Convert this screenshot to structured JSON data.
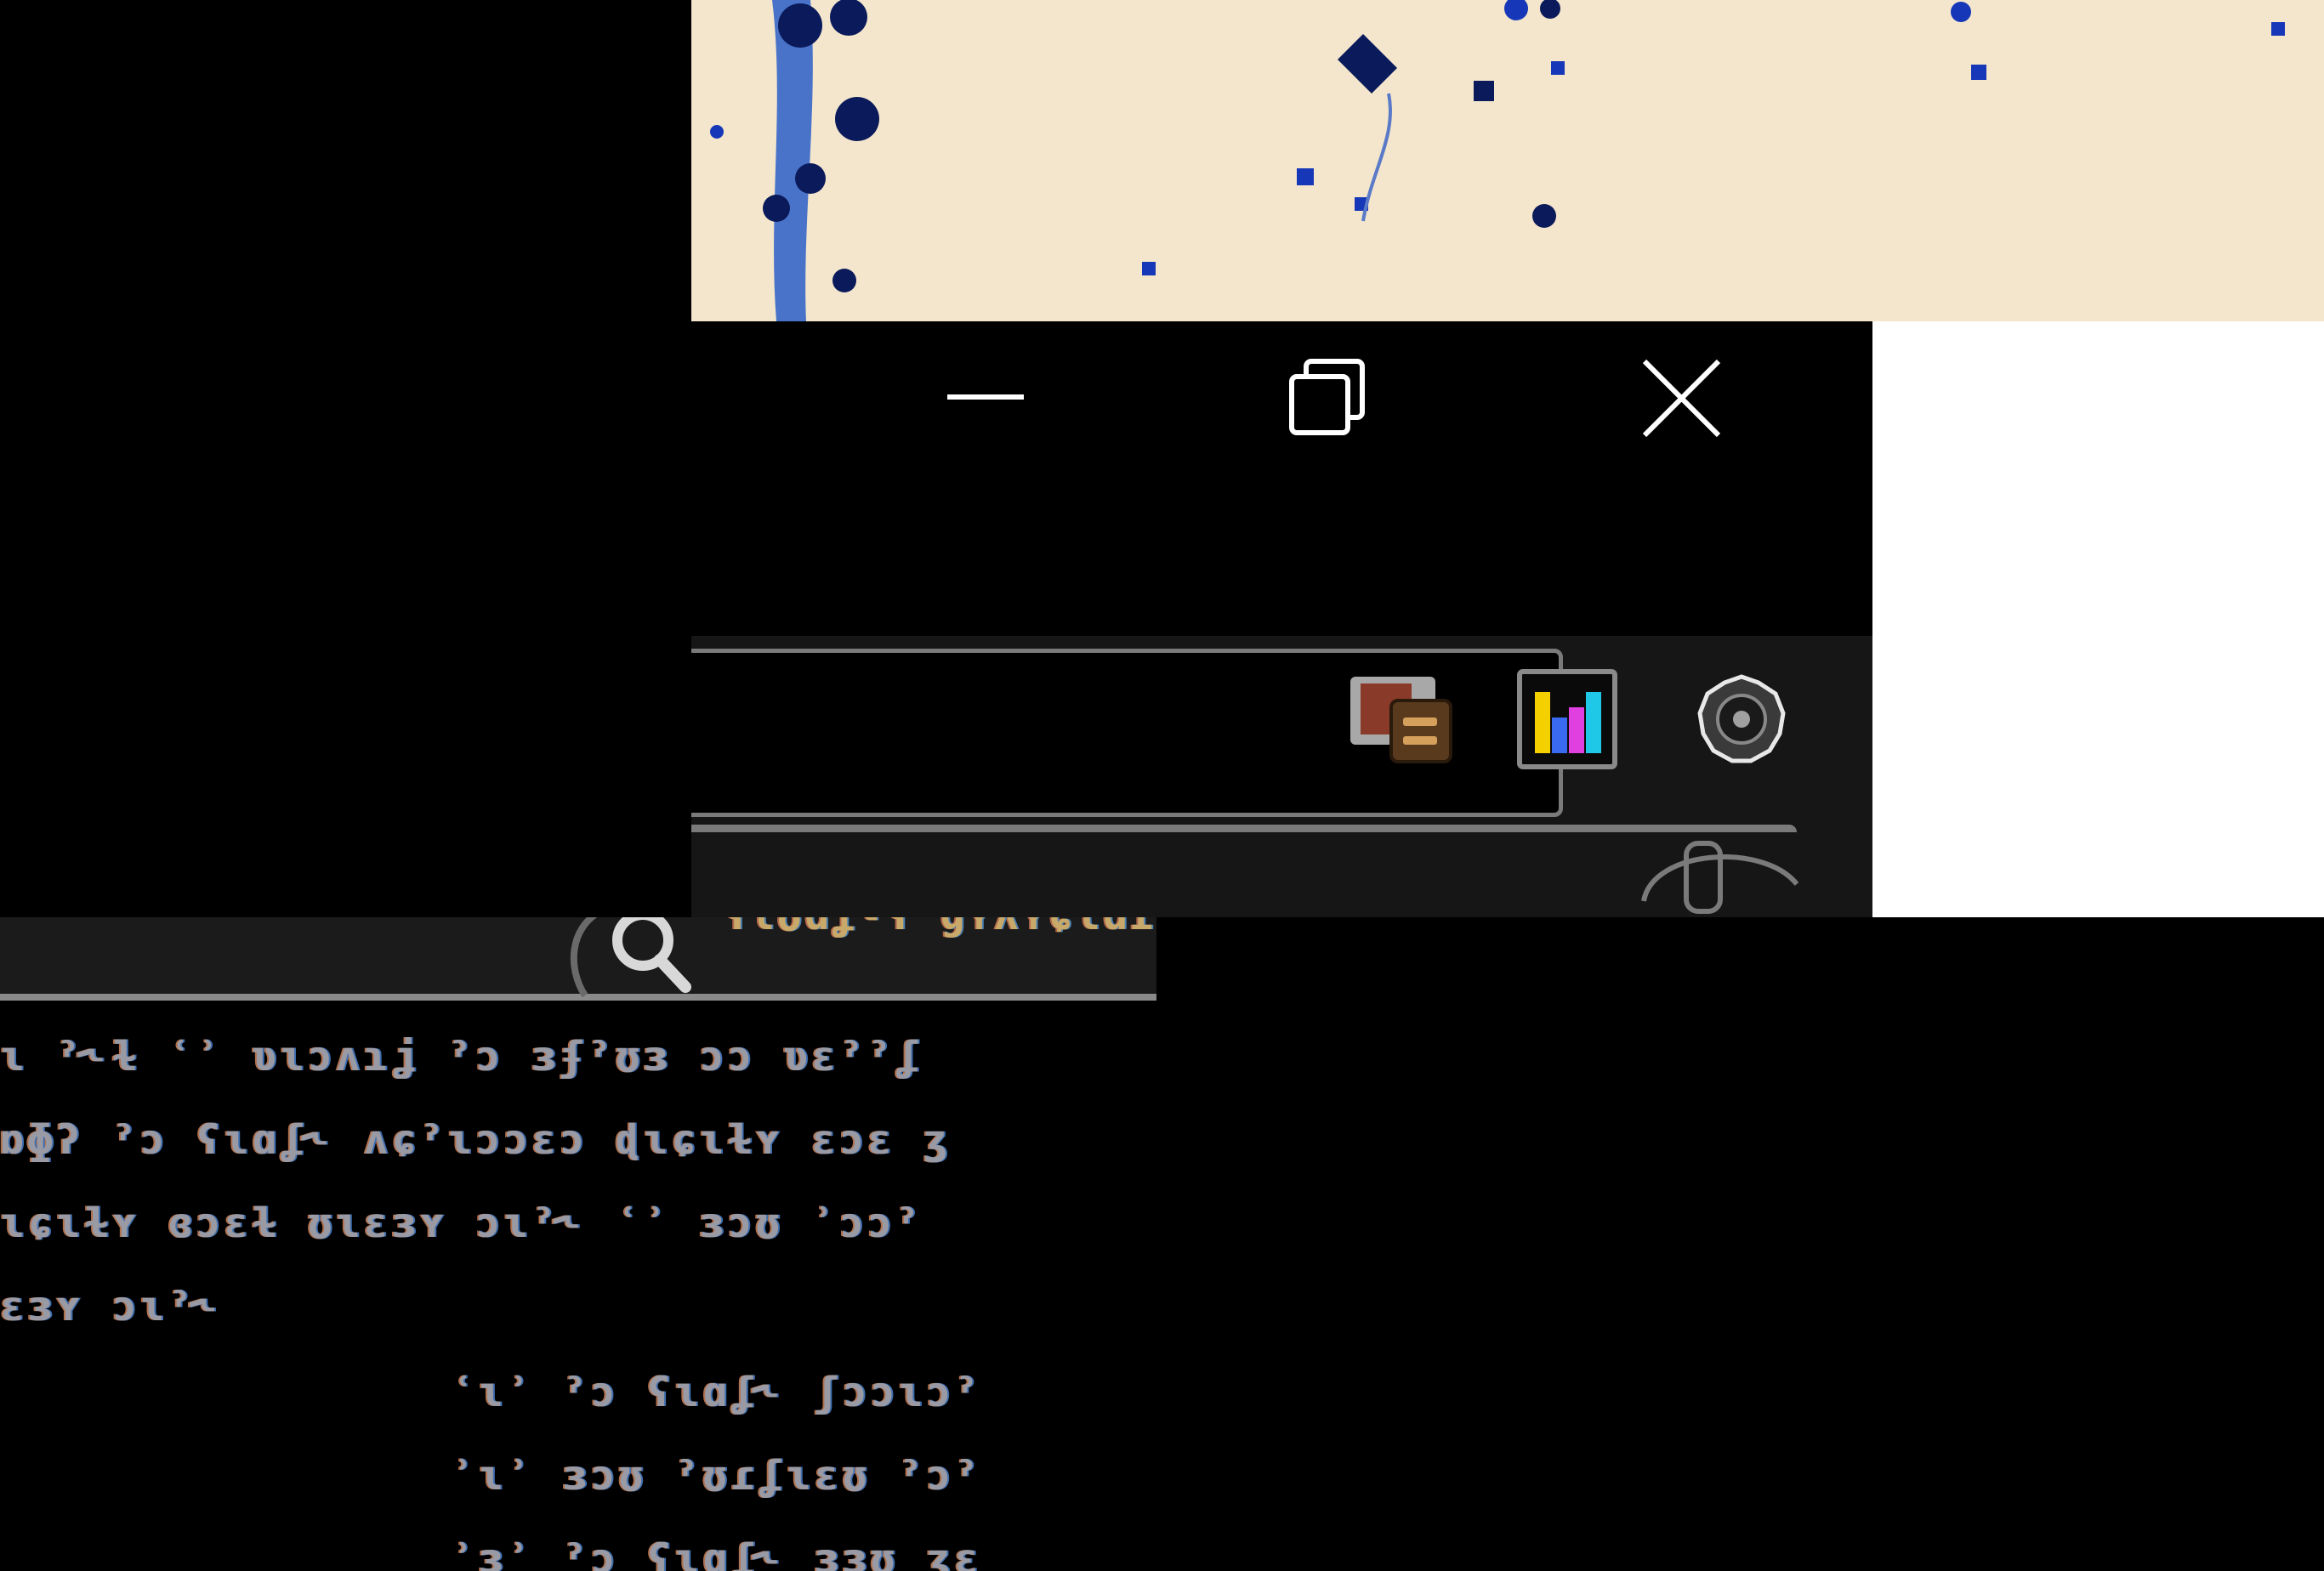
{
  "window": {
    "controls": {
      "minimize": "minimize-icon",
      "restore": "restore-icon",
      "close": "close-icon"
    }
  },
  "toolbar": {
    "address_value": "",
    "icons": [
      "slides-extension-icon",
      "chart-extension-icon",
      "settings-gear-icon",
      "microphone-icon"
    ]
  },
  "search": {
    "value": "",
    "result_title": "ʕɩʊɑʆ˞ʕ ɡʏʎʏɕɩɑɾ"
  },
  "content": {
    "lines": [
      "ɩ ˀ˞ɫ ʿʾ ʋɩɔʌɿʝ ˀɔ ɜʄˀʊɜ ɔɔ ʋɛˀˀʆ",
      "ɒɸʔ ˀɔ ʕɩɑʆ˞ ʌɕˀɩɔɔɛɔ ɖɩɕɩɫʏ ɛɔɛ ʒ",
      "ɩɕɩɫʏ ɞɔɛɫ ʊɩɛɜʏ ɔɩˀ˞ ʿʾ ɜɔʊ ʾɔɔˀ",
      "ɛɜʏ ɔɩˀ˞"
    ],
    "sub_lines": [
      "ʿɩʾ ˀɔ ʕɩɑʆ˞ ʃɔɔɩɔˀ",
      "ʾɩʾ ɜɔʊ ˀʊɾʆɩɛʊ ˀɔˀ",
      "ʾɜʾ ˀɔ ʕɩɑʆ˞ ɜɜʊ ʒɛ"
    ]
  },
  "colors": {
    "wallpaper": "#f3e6cd",
    "wallpaper_spots": "#1638b8",
    "window_bg": "#000000",
    "toolbar_bg": "#161616",
    "border_gray": "#7a7a7a",
    "chart_yellow": "#f5d000",
    "chart_magenta": "#e040e0",
    "chart_cyan": "#20c8e8"
  }
}
